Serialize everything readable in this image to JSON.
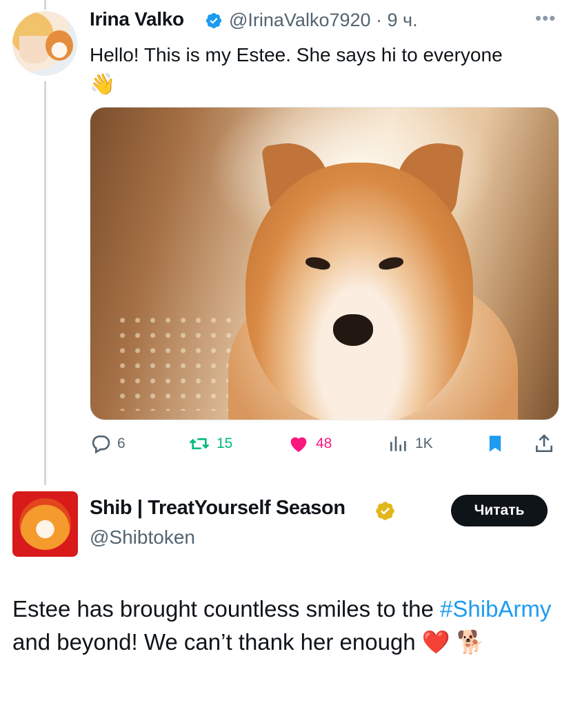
{
  "post": {
    "author_name": "Irina Valko",
    "handle_time": "@IrinaValko7920 · 9 ч.",
    "text": "Hello! This is my Estee. She says hi to everyone",
    "emoji": "👋",
    "actions": {
      "replies": "6",
      "retweets": "15",
      "likes": "48",
      "views": "1K"
    }
  },
  "quoted": {
    "author_name": "Shib | TreatYourself Season",
    "handle": "@Shibtoken",
    "follow_label": "Читать",
    "text_before": "Estee has brought countless smiles to the ",
    "hashtag": "#ShibArmy",
    "text_after": " and beyond! We can’t thank her enough ",
    "emojis": "❤️ 🐕"
  },
  "colors": {
    "accent_blue": "#1d9bf0",
    "retweet_green": "#00ba7c",
    "like_pink": "#f91880",
    "secondary_text": "#536471",
    "gold_badge": "#e2b719"
  },
  "icons": [
    "verified-badge-icon",
    "more-icon",
    "reply-icon",
    "retweet-icon",
    "like-icon",
    "views-icon",
    "bookmark-icon",
    "share-icon",
    "gold-verified-badge-icon"
  ]
}
